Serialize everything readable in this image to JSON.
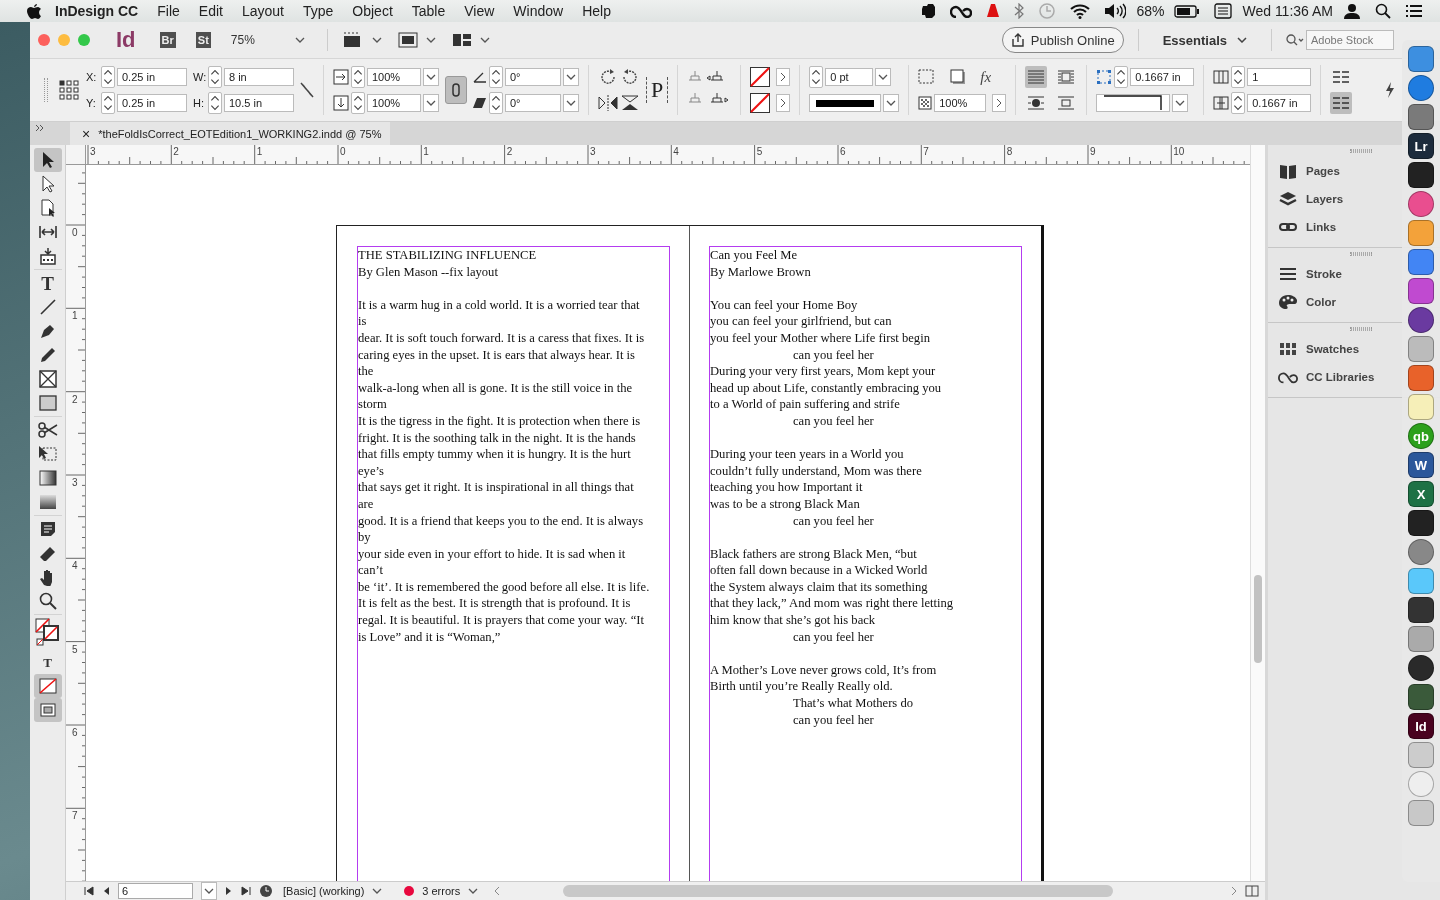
{
  "menu_bar": {
    "app_name": "InDesign CC",
    "menus": [
      "File",
      "Edit",
      "Layout",
      "Type",
      "Object",
      "Table",
      "View",
      "Window",
      "Help"
    ],
    "battery": "68%",
    "clock": "Wed 11:36 AM"
  },
  "app_bar": {
    "apps": [
      {
        "label": "Id",
        "kind": "indesign"
      },
      {
        "label": "Br",
        "kind": "box"
      },
      {
        "label": "St",
        "kind": "box"
      }
    ],
    "zoom": "75%",
    "publish_button": "Publish Online",
    "workspace": "Essentials",
    "search": {
      "placeholder": "Adobe Stock"
    }
  },
  "control_panel": {
    "position": [
      {
        "label": "X:",
        "value": "0.25 in"
      },
      {
        "label": "Y:",
        "value": "0.25 in"
      }
    ],
    "size": [
      {
        "label": "W:",
        "value": "8 in"
      },
      {
        "label": "H:",
        "value": "10.5 in"
      }
    ],
    "scale": [
      "100%",
      "100%"
    ],
    "scale_linked": true,
    "angles": [
      "0°",
      "0°"
    ],
    "frame_label": "P",
    "stroke_weight": "0 pt",
    "effects_label": "fx",
    "opacity": "100%",
    "wrap_options": [
      {
        "selected": true
      },
      {
        "selected": false
      },
      {
        "selected": false
      },
      {
        "selected": false
      }
    ],
    "inset": "0.1667 in",
    "columns": "1",
    "gutter": "0.1667 in",
    "list_options": [
      {
        "selected": false
      },
      {
        "selected": true
      }
    ]
  },
  "document_tab": {
    "close": "×",
    "title": "*theFoldIsCorrect_EOTEdition1_WORKING2.indd @ 75%"
  },
  "tool_groups": [
    [
      {
        "kind": "select",
        "selected": true
      },
      {
        "kind": "direct",
        "selected": false
      },
      {
        "kind": "page",
        "selected": false
      },
      {
        "kind": "gap",
        "selected": false
      },
      {
        "kind": "collector",
        "selected": false
      }
    ],
    [
      {
        "kind": "type",
        "label": "T",
        "selected": false
      },
      {
        "kind": "line",
        "selected": false
      },
      {
        "kind": "pen",
        "selected": false
      },
      {
        "kind": "pencil",
        "selected": false
      },
      {
        "kind": "frame",
        "selected": false
      },
      {
        "kind": "rect",
        "selected": false
      }
    ],
    [
      {
        "kind": "scissors",
        "selected": false
      },
      {
        "kind": "transform",
        "selected": false
      },
      {
        "kind": "gradient",
        "selected": false
      },
      {
        "kind": "feather",
        "selected": false
      }
    ],
    [
      {
        "kind": "note",
        "selected": false
      },
      {
        "kind": "eyedropper",
        "selected": false
      },
      {
        "kind": "hand",
        "selected": false
      },
      {
        "kind": "zoom",
        "selected": false
      }
    ],
    [
      {
        "kind": "fillstroke",
        "selected": false
      },
      {
        "kind": "formatting",
        "label": "T",
        "selected": false
      },
      {
        "kind": "none",
        "selected": true
      },
      {
        "kind": "screen",
        "selected": true
      }
    ]
  ],
  "rulers": {
    "horizontal": [
      "3",
      "2",
      "1",
      "0",
      "1",
      "2",
      "3",
      "4",
      "5",
      "6",
      "7",
      "8",
      "9",
      "10"
    ],
    "vertical": [
      "0",
      "1",
      "2",
      "3",
      "4",
      "5",
      "6",
      "7"
    ]
  },
  "spread": {
    "left_frame": [
      [
        "THE STABILIZING INFLUENCE",
        "By Glen Mason --fix layout"
      ],
      [
        "It is a warm hug in a cold world. It is a worried tear that",
        "is",
        "dear. It is soft touch forward. It is a caress that fixes. It is",
        "caring eyes in the upset. It is ears that always hear. It is",
        "the",
        "walk-a-long when all is gone. It is the still voice in the",
        "storm",
        "It is the tigress in the fight. It is protection when there is",
        "fright. It is the soothing talk in the night. It is the hands",
        "that fills empty tummy when it is hungry. It is the hurt",
        "eye’s",
        "that says get it right. It is inspirational in all things that",
        "are",
        "good. It is a friend that keeps you to the end. It is always",
        "by",
        "your side even in your effort to hide. It is sad when it",
        "can’t",
        "be ‘it’. It is remembered the good before all else. It is life.",
        "It is felt as the best. It is strength that is profound. It is",
        "regal. It is beautiful. It is prayers that come your way. “It",
        "is Love” and it is “Woman,”"
      ]
    ],
    "right_frame": [
      [
        {
          "text": "Can you Feel Me",
          "indented": false
        },
        {
          "text": "By Marlowe Brown",
          "indented": false
        }
      ],
      [
        {
          "text": "You can feel your Home Boy",
          "indented": false
        },
        {
          "text": "you can feel your girlfriend, but can",
          "indented": false
        },
        {
          "text": "you feel your Mother where Life first begin",
          "indented": false
        },
        {
          "text": "can you feel her",
          "indented": true
        },
        {
          "text": "During your very first years, Mom kept your",
          "indented": false
        },
        {
          "text": "head up about Life, constantly embracing you",
          "indented": false
        },
        {
          "text": "to a World of pain suffering and strife",
          "indented": false
        },
        {
          "text": "can you feel her",
          "indented": true
        }
      ],
      [
        {
          "text": "During your teen years in a World you",
          "indented": false
        },
        {
          "text": "couldn’t fully understand, Mom was there",
          "indented": false
        },
        {
          "text": "teaching you how Important it",
          "indented": false
        },
        {
          "text": "was to be a strong Black Man",
          "indented": false
        },
        {
          "text": "can you feel her",
          "indented": true
        }
      ],
      [
        {
          "text": "Black fathers are strong Black Men, “but",
          "indented": false
        },
        {
          "text": "often fall down because in a Wicked World",
          "indented": false
        },
        {
          "text": "the System always claim that its something",
          "indented": false
        },
        {
          "text": "that they lack,” And mom was right there letting",
          "indented": false
        },
        {
          "text": "him know that she’s got his back",
          "indented": false
        },
        {
          "text": "can you feel her",
          "indented": true
        }
      ],
      [
        {
          "text": "A Mother’s Love never grows cold, It’s from",
          "indented": false
        },
        {
          "text": "Birth until you’re Really Really old.",
          "indented": false
        },
        {
          "text": "That’s what Mothers do",
          "indented": true
        },
        {
          "text": "can you feel her",
          "indented": true
        }
      ]
    ]
  },
  "status_bar": {
    "page": "6",
    "style": "[Basic] (working)",
    "errors": "3 errors",
    "has_errors": true
  },
  "panels": [
    [
      {
        "label": "Pages",
        "kind": "pages"
      },
      {
        "label": "Layers",
        "kind": "layers"
      },
      {
        "label": "Links",
        "kind": "links"
      }
    ],
    [
      {
        "label": "Stroke",
        "kind": "stroke"
      },
      {
        "label": "Color",
        "kind": "color"
      }
    ],
    [
      {
        "label": "Swatches",
        "kind": "swatches"
      },
      {
        "label": "CC Libraries",
        "kind": "libraries"
      }
    ]
  ],
  "dock": [
    {
      "color": "#3d8fe0"
    },
    {
      "color": "#1f7ce0"
    },
    {
      "color": "#7a7a7a"
    },
    {
      "color": "#1c2b3c",
      "label": "Lr"
    },
    {
      "color": "#222222"
    },
    {
      "color": "#e94e8f"
    },
    {
      "color": "#f3a23a"
    },
    {
      "color": "#4285f4"
    },
    {
      "color": "#c04ad0"
    },
    {
      "color": "#6a3aa0"
    },
    {
      "color": "#bbbbbb"
    },
    {
      "color": "#e8622a"
    },
    {
      "color": "#f6efb8"
    },
    {
      "color": "#2ca01c",
      "label": "qb"
    },
    {
      "color": "#2b579a",
      "label": "W"
    },
    {
      "color": "#1e7145",
      "label": "X"
    },
    {
      "color": "#222222"
    },
    {
      "color": "#888888"
    },
    {
      "color": "#5ac8fa"
    },
    {
      "color": "#333333"
    },
    {
      "color": "#aaaaaa"
    },
    {
      "color": "#2a2a2a"
    },
    {
      "color": "#3a5a3a"
    },
    {
      "color": "#49021f",
      "label": "Id"
    },
    {
      "color": "#cccccc"
    },
    {
      "color": "#eeeeee"
    },
    {
      "color": "#c8c8c8"
    }
  ]
}
